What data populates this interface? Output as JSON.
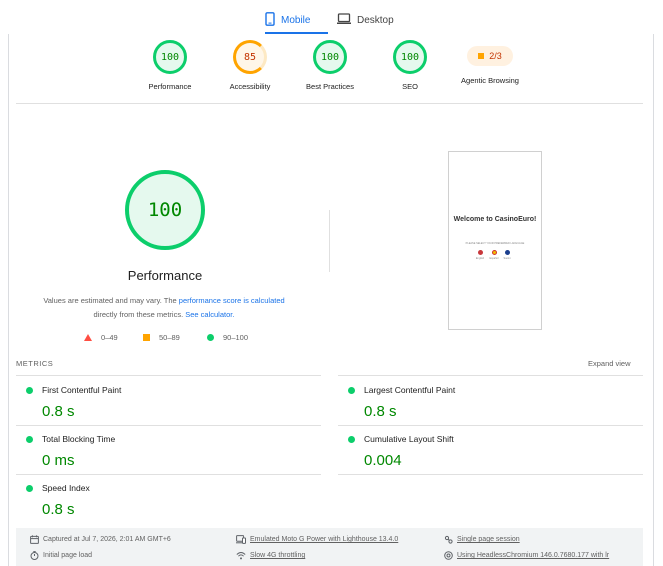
{
  "tabs": {
    "mobile": "Mobile",
    "desktop": "Desktop"
  },
  "gauges": [
    {
      "score": "100",
      "label": "Performance",
      "status": "pass"
    },
    {
      "score": "85",
      "label": "Accessibility",
      "status": "average"
    },
    {
      "score": "100",
      "label": "Best Practices",
      "status": "pass"
    },
    {
      "score": "100",
      "label": "SEO",
      "status": "pass"
    }
  ],
  "agentic": {
    "badge": "2/3",
    "label": "Agentic Browsing"
  },
  "performance": {
    "score": "100",
    "title": "Performance",
    "note_start": "Values are estimated and may vary. The ",
    "note_link": "performance score is calculated",
    "note_mid": " directly from these metrics. ",
    "note_link2": "See calculator."
  },
  "legend": {
    "fail": "0–49",
    "average": "50–89",
    "pass": "90–100"
  },
  "screenshot": {
    "title": "Welcome to CasinoEuro!",
    "subtitle": "PLEASE SELECT YOUR PREFERRED LANGUAGE",
    "langs": [
      "English",
      "Español",
      "Suomi"
    ]
  },
  "metrics": {
    "title": "METRICS",
    "expand": "Expand view",
    "items": [
      {
        "name": "First Contentful Paint",
        "value": "0.8 s"
      },
      {
        "name": "Largest Contentful Paint",
        "value": "0.8 s"
      },
      {
        "name": "Total Blocking Time",
        "value": "0 ms"
      },
      {
        "name": "Cumulative Layout Shift",
        "value": "0.004"
      },
      {
        "name": "Speed Index",
        "value": "0.8 s"
      }
    ]
  },
  "footer": {
    "captured": "Captured at Jul 7, 2026, 2:01 AM GMT+6",
    "device": "Emulated Moto G Power with Lighthouse 13.4.0",
    "session": "Single page session",
    "load": "Initial page load",
    "throttling": "Slow 4G throttling",
    "browser": "Using HeadlessChromium 146.0.7680.177 with lr"
  },
  "colors": {
    "pass": "#0cce6b",
    "average": "#ffa400",
    "fail": "#ff4e42",
    "accent": "#1a73e8"
  }
}
